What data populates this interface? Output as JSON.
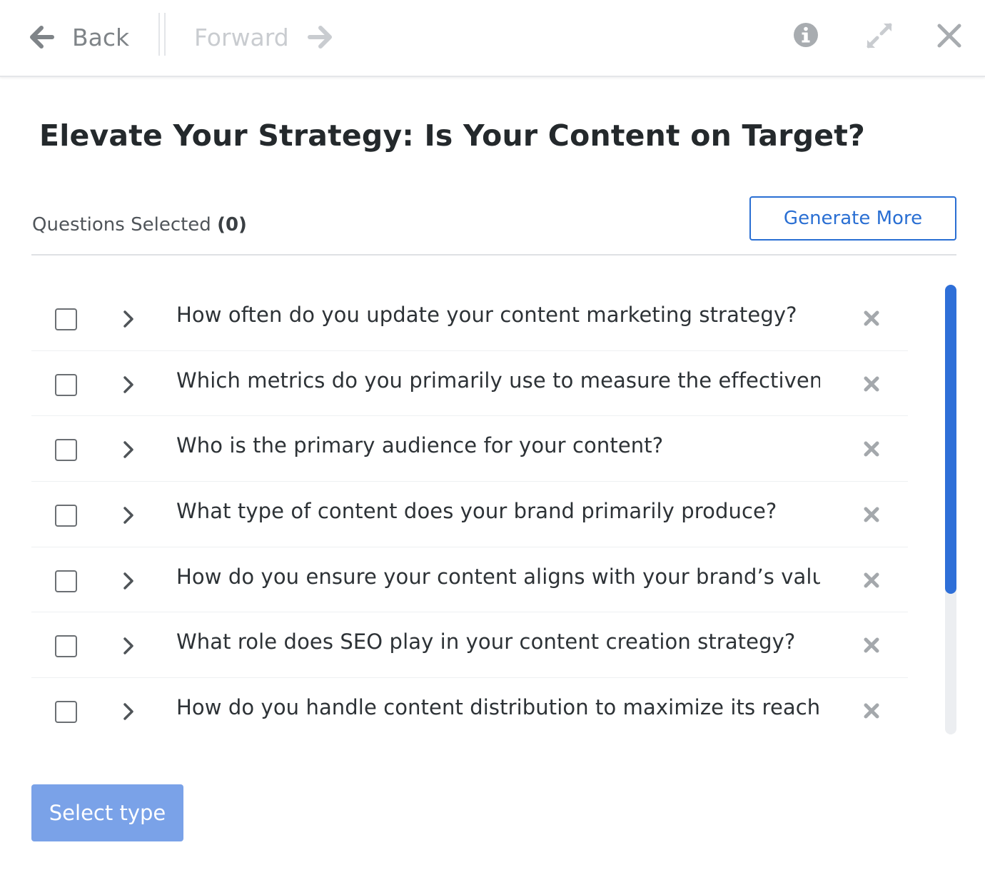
{
  "nav": {
    "back_label": "Back",
    "forward_label": "Forward",
    "icons": [
      "arrow-left-icon",
      "arrow-right-icon",
      "info-icon",
      "expand-icon",
      "close-icon"
    ]
  },
  "title": "Elevate Your Strategy: Is Your Content on Target?",
  "selection": {
    "label": "Questions Selected",
    "count": "(0)"
  },
  "generate_more_label": "Generate More",
  "questions": [
    {
      "text": "How often do you update your content marketing strategy?",
      "checked": false
    },
    {
      "text": "Which metrics do you primarily use to measure the effectiveness of your content?",
      "checked": false
    },
    {
      "text": "Who is the primary audience for your content?",
      "checked": false
    },
    {
      "text": "What type of content does your brand primarily produce?",
      "checked": false
    },
    {
      "text": "How do you ensure your content aligns with your brand’s values?",
      "checked": false
    },
    {
      "text": "What role does SEO play in your content creation strategy?",
      "checked": false
    },
    {
      "text": "How do you handle content distribution to maximize its reach?",
      "checked": false
    }
  ],
  "select_type_label": "Select type",
  "colors": {
    "accent": "#2a6fd3",
    "scroll_thumb": "#2e6fd8",
    "select_button": "#7aa2e8",
    "muted_nav": "#7f8488",
    "disabled_nav": "#c9ccd0"
  }
}
